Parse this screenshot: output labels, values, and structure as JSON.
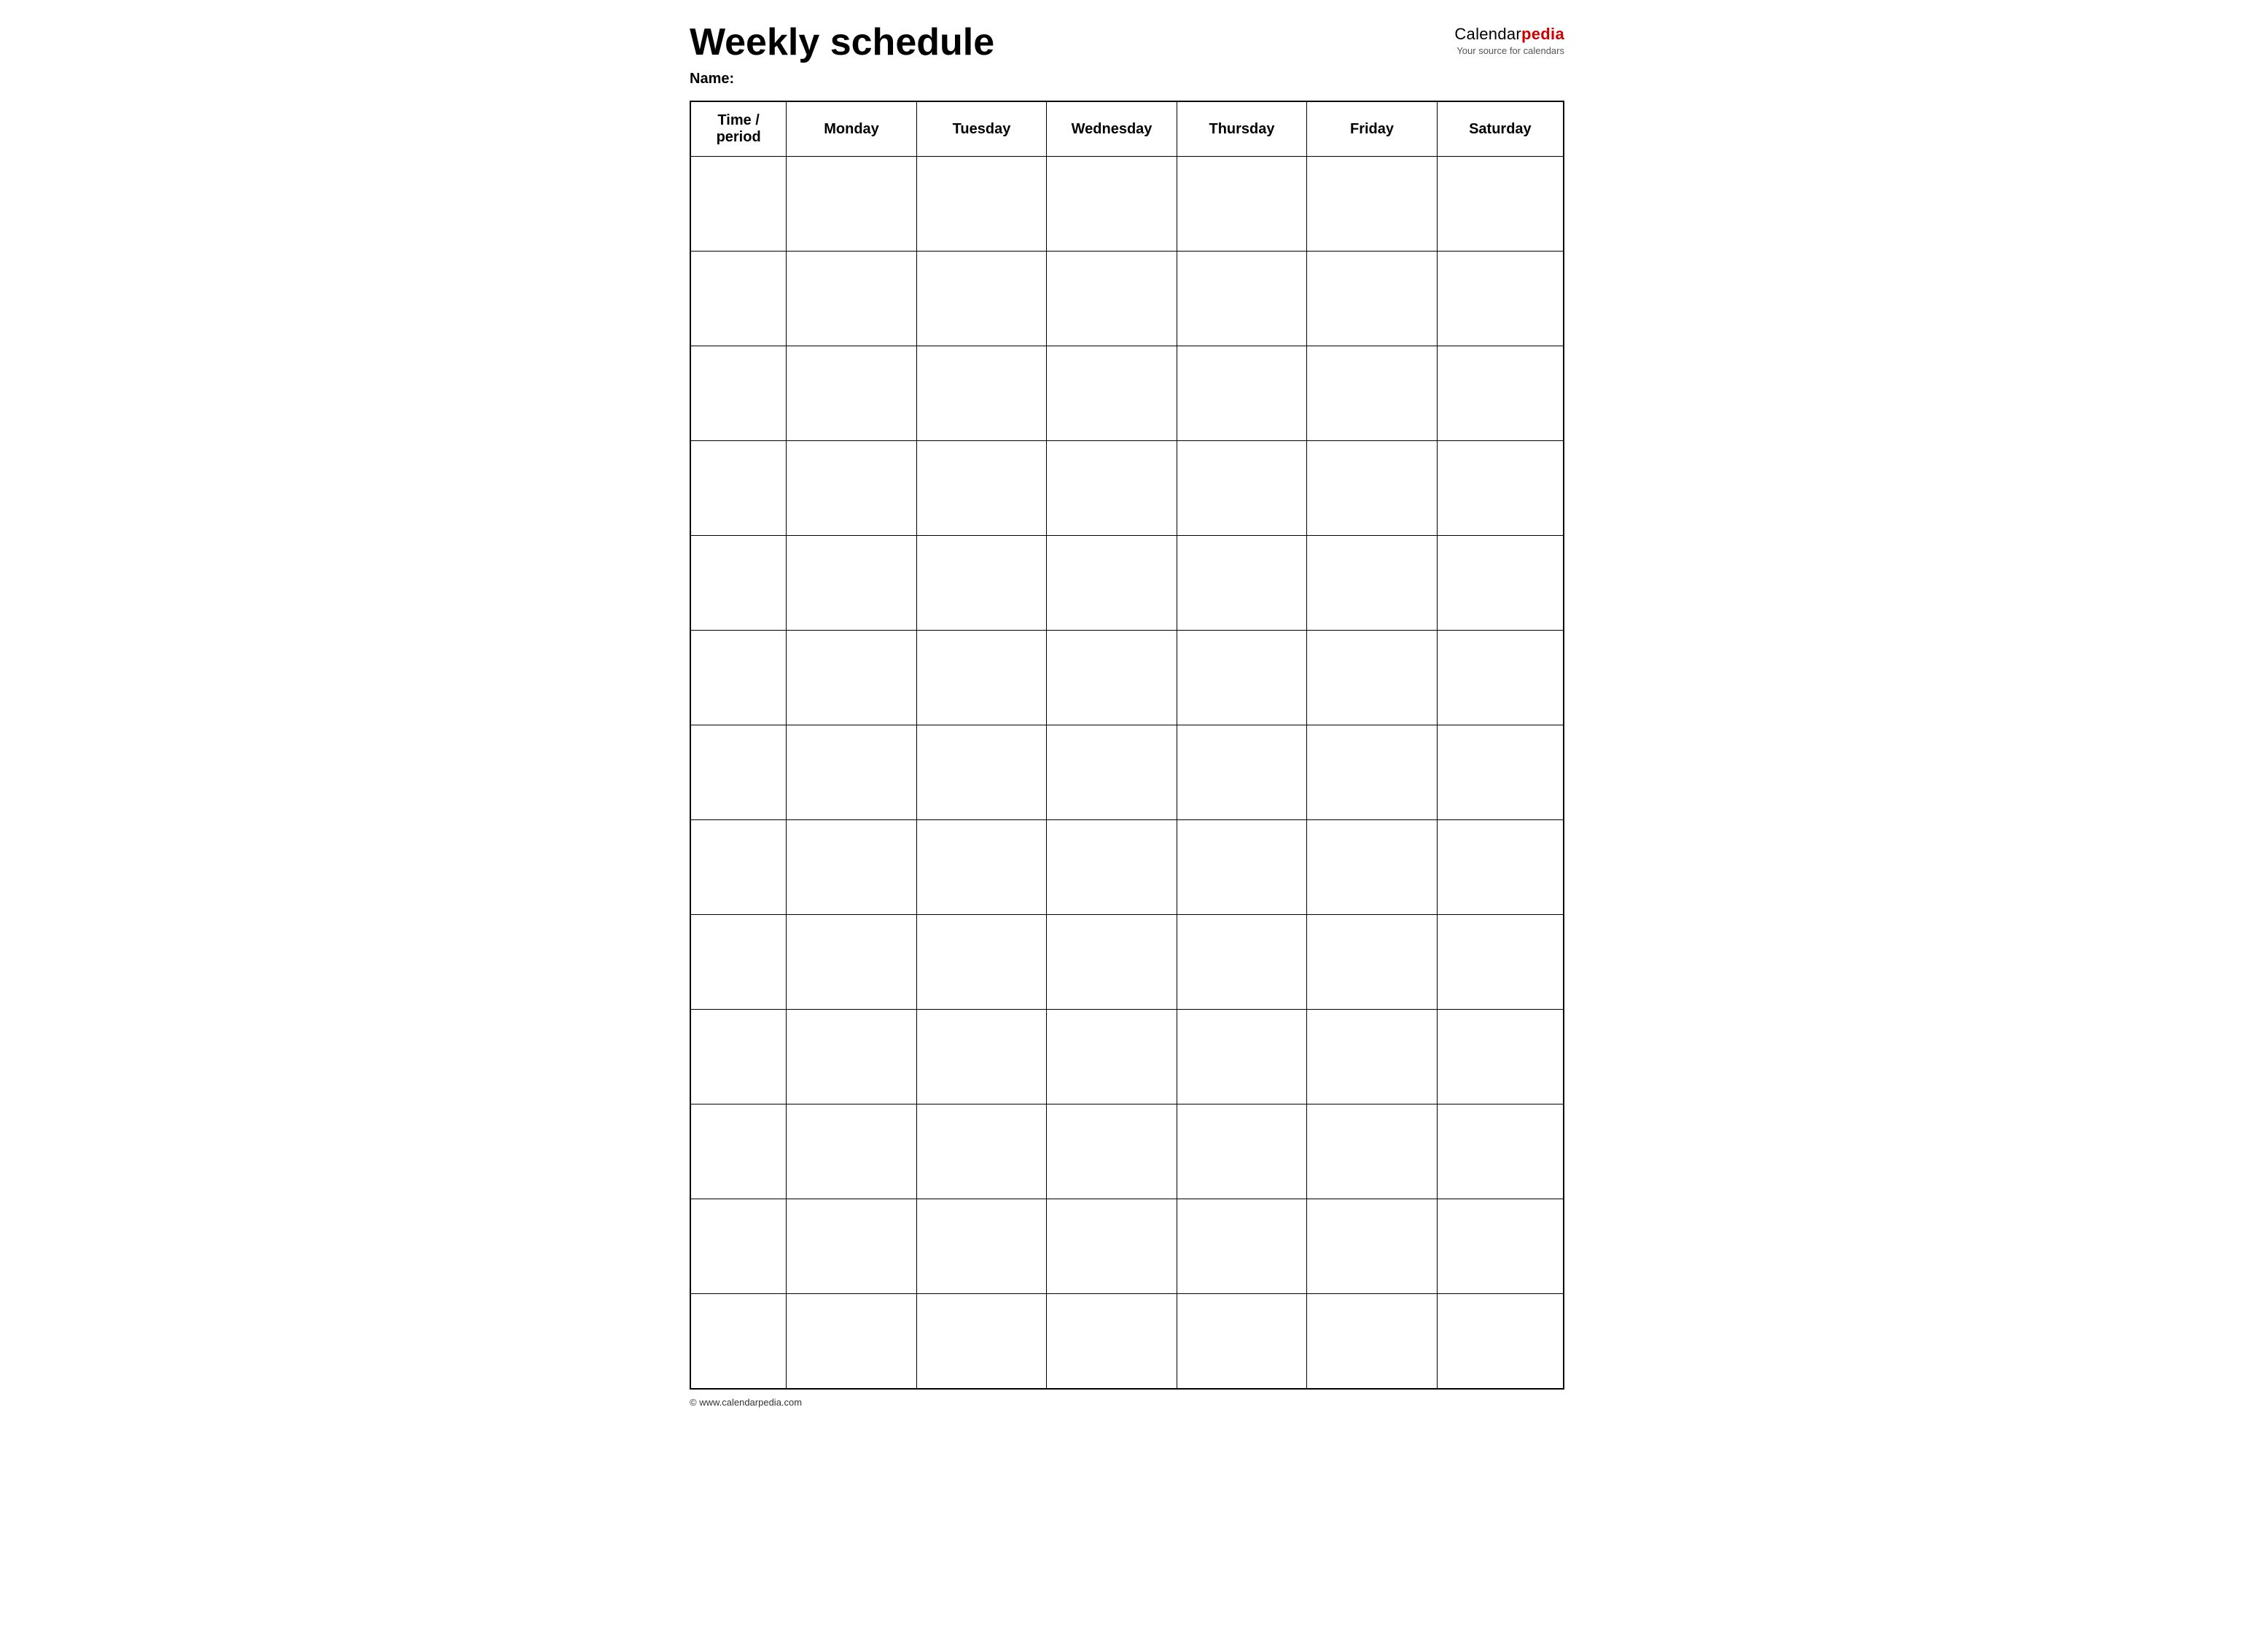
{
  "header": {
    "title": "Weekly schedule",
    "logo_calendar": "Calendar",
    "logo_pedia": "pedia",
    "logo_tagline": "Your source for calendars"
  },
  "name_label": "Name:",
  "columns": [
    "Time / period",
    "Monday",
    "Tuesday",
    "Wednesday",
    "Thursday",
    "Friday",
    "Saturday"
  ],
  "rows": 13,
  "footer": {
    "url": "© www.calendarpedia.com"
  }
}
